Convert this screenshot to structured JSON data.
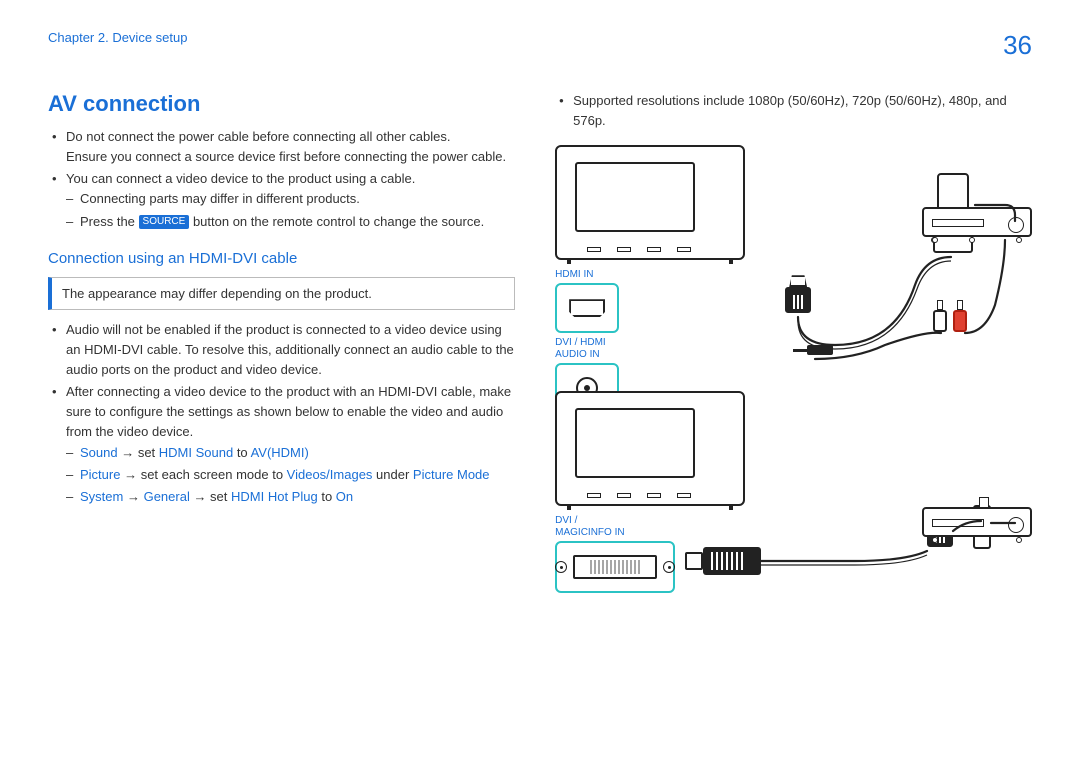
{
  "header": {
    "chapter": "Chapter 2. Device setup",
    "page_number": "36"
  },
  "title": "AV connection",
  "bullets": {
    "b1a": "Do not connect the power cable before connecting all other cables.",
    "b1b": "Ensure you connect a source device first before connecting the power cable.",
    "b2": "You can connect a video device to the product using a cable.",
    "b2s1": "Connecting parts may differ in different products.",
    "b2s2a": "Press the ",
    "b2s2_btn": "SOURCE",
    "b2s2b": " button on the remote control to change the source."
  },
  "subheading": "Connection using an HDMI-DVI cable",
  "note": "The appearance may differ depending on the product.",
  "body": {
    "p1": "Audio will not be enabled if the product is connected to a video device using an HDMI-DVI cable. To resolve this, additionally connect an audio cable to the audio ports on the product and video device.",
    "p2": "After connecting a video device to the product with an HDMI-DVI cable, make sure to configure the settings as shown below to enable the video and audio from the video device.",
    "s1_a": "Sound",
    "s1_b": " → set ",
    "s1_c": "HDMI Sound",
    "s1_d": " to ",
    "s1_e": "AV(HDMI)",
    "s2_a": "Picture",
    "s2_b": " → set each screen mode to ",
    "s2_c": "Videos/Images",
    "s2_d": " under ",
    "s2_e": "Picture Mode",
    "s3_a": "System",
    "s3_b": " → ",
    "s3_c": "General",
    "s3_d": " → set ",
    "s3_e": "HDMI Hot Plug",
    "s3_f": " to ",
    "s3_g": "On"
  },
  "right": {
    "resolutions": "Supported resolutions include 1080p (50/60Hz), 720p (50/60Hz), 480p, and 576p.",
    "label_hdmi_in": "HDMI IN",
    "label_audio_in_1": "DVI / HDMI",
    "label_audio_in_2": "AUDIO IN",
    "label_dvi_1": "DVI /",
    "label_dvi_2": "MAGICINFO IN"
  }
}
